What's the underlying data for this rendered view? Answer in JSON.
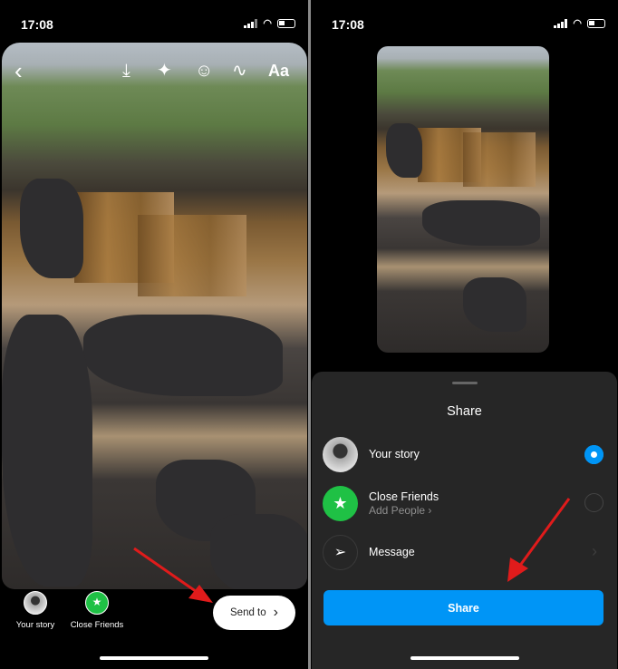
{
  "status_bar": {
    "time": "17:08"
  },
  "left_screen": {
    "toolbar": {
      "back": "‹",
      "text_tool": "Aa"
    },
    "destinations": [
      {
        "label": "Your story"
      },
      {
        "label": "Close Friends"
      }
    ],
    "send_to_label": "Send to"
  },
  "right_screen": {
    "sheet": {
      "title": "Share",
      "options": [
        {
          "label": "Your story",
          "selected": true
        },
        {
          "label": "Close Friends",
          "sublabel": "Add People ›",
          "selected": false
        },
        {
          "label": "Message"
        }
      ],
      "share_button": "Share"
    }
  },
  "colors": {
    "accent": "#0095f6",
    "close_friends": "#1fc145",
    "sheet_bg": "#262626",
    "annotation_arrow": "#e01b1b"
  }
}
